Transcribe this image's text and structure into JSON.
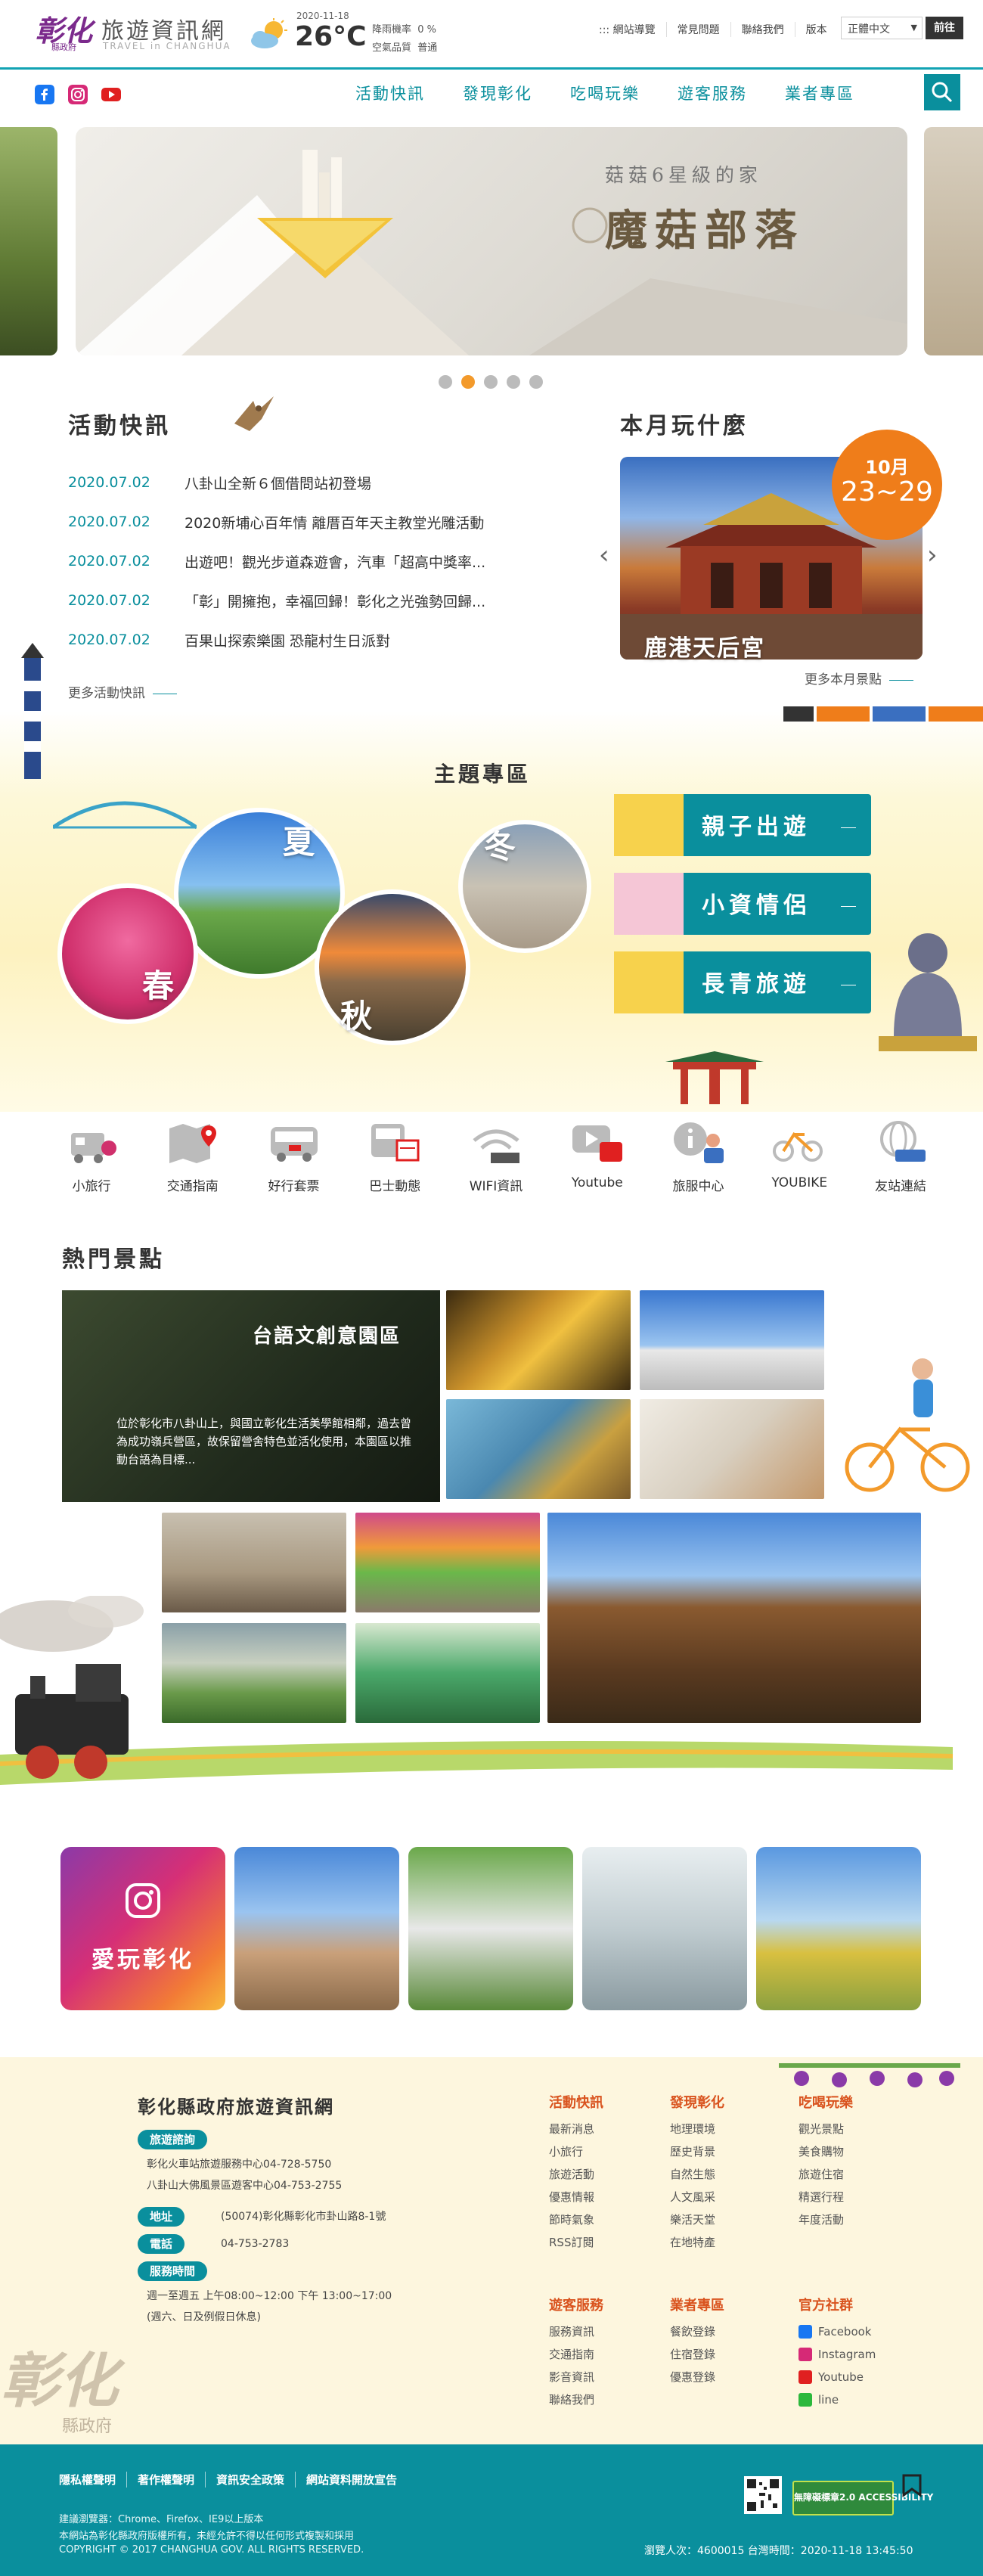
{
  "header": {
    "logo_main": "彰化",
    "logo_sub": "縣政府",
    "site_title": "旅遊資訊網",
    "site_subtitle": "TRAVEL in CHANGHUA",
    "weather": {
      "date": "2020-11-18",
      "icon": "partly-cloudy-icon",
      "temperature": "26°C",
      "rain_label": "降雨機率",
      "rain_value": "0 %",
      "air_label": "空氣品質",
      "air_value": "普通"
    },
    "top_links": [
      "::: 網站導覽",
      "常見問題",
      "聯絡我們",
      "版本"
    ],
    "language_selected": "正體中文",
    "go_label": "前往"
  },
  "nav": {
    "social": [
      "facebook-icon",
      "instagram-icon",
      "youtube-icon"
    ],
    "items": [
      "活動快訊",
      "發現彰化",
      "吃喝玩樂",
      "遊客服務",
      "業者專區"
    ]
  },
  "hero": {
    "subtitle": "菇菇6星級的家",
    "title": "魔菇部落",
    "slide_count": 5,
    "active_slide": 2
  },
  "news": {
    "title": "活動快訊",
    "items": [
      {
        "date": "2020.07.02",
        "text": "八卦山全新６個借問站初登場"
      },
      {
        "date": "2020.07.02",
        "text": "2020新埔心百年情 離厝百年天主教堂光雕活動"
      },
      {
        "date": "2020.07.02",
        "text": "出遊吧！觀光步道森遊會，汽車「超高中獎率..."
      },
      {
        "date": "2020.07.02",
        "text": "「彰」開擁抱，幸福回歸！彰化之光強勢回歸..."
      },
      {
        "date": "2020.07.02",
        "text": "百果山探索樂園 恐龍村生日派對"
      }
    ],
    "more": "更多活動快訊"
  },
  "month": {
    "title": "本月玩什麼",
    "badge_month": "10月",
    "badge_dates": "23~29",
    "caption": "鹿港天后宮",
    "more": "更多本月景點"
  },
  "theme": {
    "title": "主題專區",
    "seasons": [
      "春",
      "夏",
      "秋",
      "冬"
    ],
    "buttons": [
      "親子出遊",
      "小資情侶",
      "長青旅遊"
    ]
  },
  "quick_links": [
    {
      "icon": "train-icon",
      "label": "小旅行"
    },
    {
      "icon": "map-pin-icon",
      "label": "交通指南"
    },
    {
      "icon": "bus-icon",
      "label": "好行套票"
    },
    {
      "icon": "bus-schedule-icon",
      "label": "巴士動態"
    },
    {
      "icon": "wifi-icon",
      "label": "WIFI資訊"
    },
    {
      "icon": "youtube-icon",
      "label": "Youtube"
    },
    {
      "icon": "info-center-icon",
      "label": "旅服中心"
    },
    {
      "icon": "youbike-icon",
      "label": "YOUBIKE"
    },
    {
      "icon": "link-icon",
      "label": "友站連結"
    }
  ],
  "hot_spots": {
    "title": "熱門景點",
    "feature_title": "台語文創意園區",
    "feature_desc": "位於彰化市八卦山上，與國立彰化生活美學館相鄰，過去曾為成功嶺兵營區，故保留營舍特色並活化使用，本園區以推動台語為目標..."
  },
  "instagram": {
    "label": "愛玩彰化"
  },
  "footer": {
    "title": "彰化縣政府旅遊資訊網",
    "inquiry_label": "旅遊諮詢",
    "inquiry_lines": [
      "彰化火車站旅遊服務中心04-728-5750",
      "八卦山大佛風景區遊客中心04-753-2755"
    ],
    "address_label": "地址",
    "address": "(50074)彰化縣彰化市卦山路8-1號",
    "phone_label": "電話",
    "phone": "04-753-2783",
    "hours_label": "服務時間",
    "hours_lines": [
      "週一至週五 上午08:00~12:00 下午 13:00~17:00",
      "(週六、日及例假日休息)"
    ],
    "columns": [
      {
        "heading": "活動快訊",
        "items": [
          "最新消息",
          "小旅行",
          "旅遊活動",
          "優惠情報",
          "節時氣象",
          "RSS訂閱"
        ]
      },
      {
        "heading": "發現彰化",
        "items": [
          "地理環境",
          "歷史背景",
          "自然生態",
          "人文風采",
          "樂活天堂",
          "在地特產"
        ]
      },
      {
        "heading": "吃喝玩樂",
        "items": [
          "觀光景點",
          "美食購物",
          "旅遊住宿",
          "精選行程",
          "年度活動"
        ]
      },
      {
        "heading": "遊客服務",
        "items": [
          "服務資訊",
          "交通指南",
          "影音資訊",
          "聯絡我們"
        ]
      },
      {
        "heading": "業者專區",
        "items": [
          "餐飲登錄",
          "住宿登錄",
          "優惠登錄"
        ]
      },
      {
        "heading": "官方社群",
        "items": [
          "Facebook",
          "Instagram",
          "Youtube",
          "line"
        ]
      }
    ],
    "seal_main": "彰化",
    "seal_sub": "縣政府"
  },
  "bottom": {
    "links": [
      "隱私權聲明",
      "著作權聲明",
      "資訊安全政策",
      "網站資料開放宣告"
    ],
    "browser_note": "建議瀏覽器：Chrome、Firefox、IE9以上版本",
    "rights_note": "本網站為彰化縣政府版權所有，未經允許不得以任何形式複製和採用",
    "copyright": "COPYRIGHT © 2017 CHANGHUA GOV. ALL RIGHTS RESERVED.",
    "visitors": "瀏覽人次：4600015 台灣時間：2020-11-18 13:45:50",
    "access_badge": "無障礙標章2.0 ACCESSIBILITY"
  },
  "colors": {
    "teal": "#0a8f9d",
    "orange": "#ef7d1a",
    "purple": "#7b2a8c",
    "footer_bg": "#fdf6de"
  }
}
